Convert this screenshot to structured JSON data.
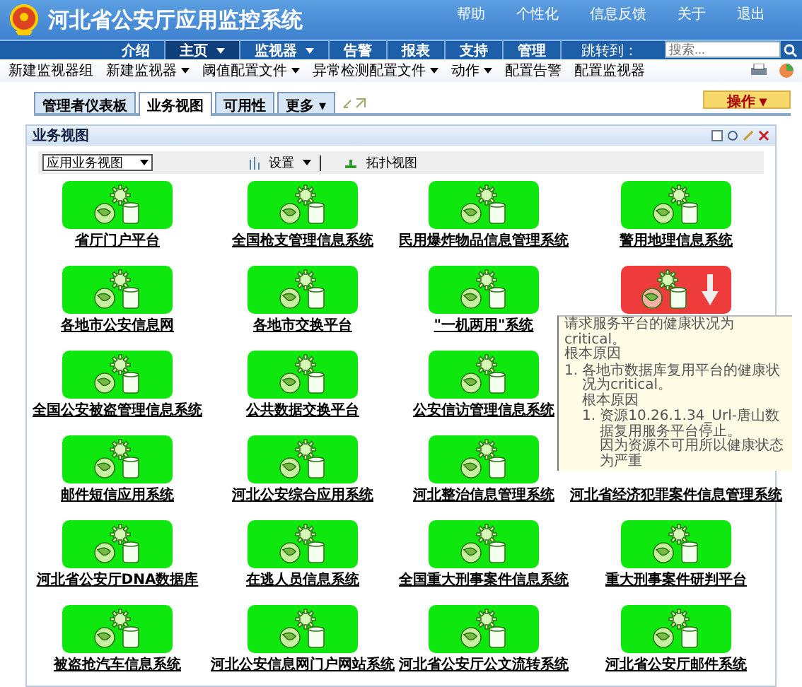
{
  "header": {
    "title": "河北省公安厅应用监控系统",
    "links": [
      "帮助",
      "个性化",
      "信息反馈",
      "关于",
      "退出"
    ]
  },
  "nav": {
    "items": [
      {
        "label": "介绍",
        "selected": false,
        "dropdown": false
      },
      {
        "label": "主页",
        "selected": true,
        "dropdown": true
      },
      {
        "label": "监视器",
        "selected": false,
        "dropdown": true
      },
      {
        "label": "告警",
        "selected": false,
        "dropdown": false
      },
      {
        "label": "报表",
        "selected": false,
        "dropdown": false
      },
      {
        "label": "支持",
        "selected": false,
        "dropdown": false
      },
      {
        "label": "管理",
        "selected": false,
        "dropdown": false
      }
    ],
    "jump_label": "跳转到：",
    "search": {
      "placeholder": "搜索..."
    }
  },
  "toolbar": [
    {
      "label": "新建监视器组",
      "dropdown": false
    },
    {
      "label": "新建监视器",
      "dropdown": true
    },
    {
      "label": "阈值配置文件",
      "dropdown": true
    },
    {
      "label": "异常检测配置文件",
      "dropdown": true
    },
    {
      "label": "动作",
      "dropdown": true
    },
    {
      "label": "配置告警",
      "dropdown": false
    },
    {
      "label": "配置监视器",
      "dropdown": false
    }
  ],
  "tabs": [
    {
      "label": "管理者仪表板",
      "selected": false
    },
    {
      "label": "业务视图",
      "selected": true
    },
    {
      "label": "可用性",
      "selected": false
    },
    {
      "label": "更多 ▾",
      "selected": false
    }
  ],
  "action_button": "操作 ▾",
  "panel": {
    "title": "业务视图",
    "view_select": "应用业务视图",
    "settings": "设置",
    "topology": "拓扑视图",
    "tiles": [
      {
        "kind": "tile",
        "label": "省厅门户平台",
        "critical": false
      },
      {
        "kind": "tile",
        "label": "全国枪支管理信息系统",
        "critical": false
      },
      {
        "kind": "tile",
        "label": "民用爆炸物品信息管理系统",
        "critical": false
      },
      {
        "kind": "tile",
        "label": "警用地理信息系统",
        "critical": false
      },
      {
        "kind": "tile",
        "label": "各地市公安信息网",
        "critical": false
      },
      {
        "kind": "tile",
        "label": "各地市交换平台",
        "critical": false
      },
      {
        "kind": "tile",
        "label": "\"一机两用\"系统",
        "critical": false
      },
      {
        "kind": "tile",
        "critical": true
      },
      {
        "kind": "tile",
        "label": "全国公安被盗管理信息系统",
        "critical": false
      },
      {
        "kind": "tile",
        "label": "公共数据交换平台",
        "critical": false
      },
      {
        "kind": "tile",
        "label": "公安信访管理信息系统",
        "critical": false
      },
      {
        "kind": "hidden"
      },
      {
        "kind": "tile",
        "label": "邮件短信应用系统",
        "critical": false
      },
      {
        "kind": "tile",
        "label": "河北公安综合应用系统",
        "critical": false
      },
      {
        "kind": "tile",
        "label": "河北整治信息管理系统",
        "critical": false
      },
      {
        "kind": "label_only",
        "label": "河北省经济犯罪案件信息管理系统"
      },
      {
        "kind": "tile",
        "label": "河北省公安厅DNA数据库",
        "critical": false
      },
      {
        "kind": "tile",
        "label": "在逃人员信息系统",
        "critical": false
      },
      {
        "kind": "tile",
        "label": "全国重大刑事案件信息系统",
        "critical": false
      },
      {
        "kind": "tile",
        "label": "重大刑事案件研判平台",
        "critical": false
      },
      {
        "kind": "tile",
        "label": "被盗抢汽车信息系统",
        "critical": false
      },
      {
        "kind": "tile",
        "label": "河北公安信息网门户网站系统",
        "critical": false
      },
      {
        "kind": "tile",
        "label": "河北省公安厅公文流转系统",
        "critical": false
      },
      {
        "kind": "tile",
        "label": "河北省公安厅邮件系统",
        "critical": false
      }
    ]
  },
  "tooltip": {
    "summary": "请求服务平台的健康状况为critical。",
    "cause_title": "根本原因",
    "items": [
      {
        "marker": "1.",
        "text": "各地市数据库复用平台的健康状况为critical。",
        "cause_title": "根本原因",
        "children": [
          {
            "marker": "1.",
            "text": "资源10.26.1.34_Url-唐山数据复用服务平台停止。",
            "reason": "因为资源不可用所以健康状态为严重"
          }
        ]
      }
    ]
  }
}
